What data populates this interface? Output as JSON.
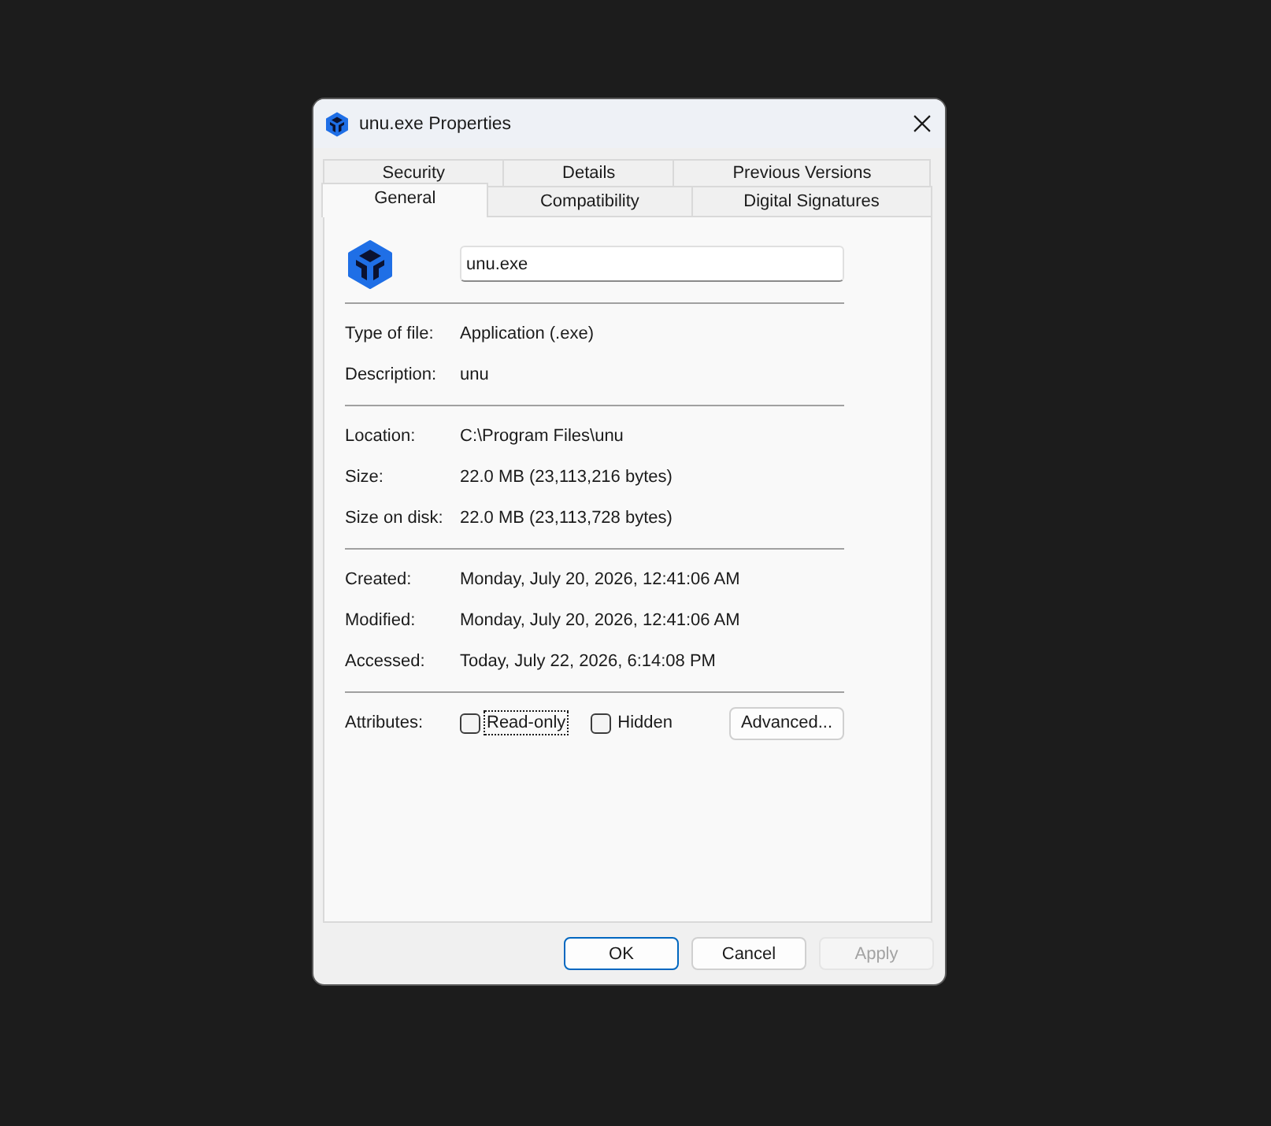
{
  "window": {
    "title": "unu.exe Properties"
  },
  "tab_rows": [
    [
      {
        "label": "Security",
        "selected": false
      },
      {
        "label": "Details",
        "selected": false
      },
      {
        "label": "Previous Versions",
        "selected": false
      }
    ],
    [
      {
        "label": "General",
        "selected": true
      },
      {
        "label": "Compatibility",
        "selected": false
      },
      {
        "label": "Digital Signatures",
        "selected": false
      }
    ]
  ],
  "general": {
    "file_name": {
      "value": "unu.exe"
    },
    "sections": [
      [
        {
          "label": "Type of file:",
          "value": "Application (.exe)"
        },
        {
          "label": "Description:",
          "value": "unu"
        }
      ],
      [
        {
          "label": "Location:",
          "value": "C:\\Program Files\\unu"
        },
        {
          "label": "Size:",
          "value": "22.0 MB (23,113,216 bytes)"
        },
        {
          "label": "Size on disk:",
          "value": "22.0 MB (23,113,728 bytes)"
        }
      ],
      [
        {
          "label": "Created:",
          "value": "Monday, July 20, 2026, 12:41:06 AM"
        },
        {
          "label": "Modified:",
          "value": "Monday, July 20, 2026, 12:41:06 AM"
        },
        {
          "label": "Accessed:",
          "value": "Today, July 22, 2026, 6:14:08 PM"
        }
      ]
    ],
    "attributes": {
      "label": "Attributes:",
      "checkboxes": [
        {
          "label": "Read-only",
          "checked": false,
          "focused": true
        },
        {
          "label": "Hidden",
          "checked": false,
          "focused": false
        }
      ],
      "advanced_button": "Advanced..."
    }
  },
  "buttons": [
    {
      "label": "OK",
      "default": true,
      "disabled": false
    },
    {
      "label": "Cancel",
      "default": false,
      "disabled": false
    },
    {
      "label": "Apply",
      "default": false,
      "disabled": true
    }
  ]
}
